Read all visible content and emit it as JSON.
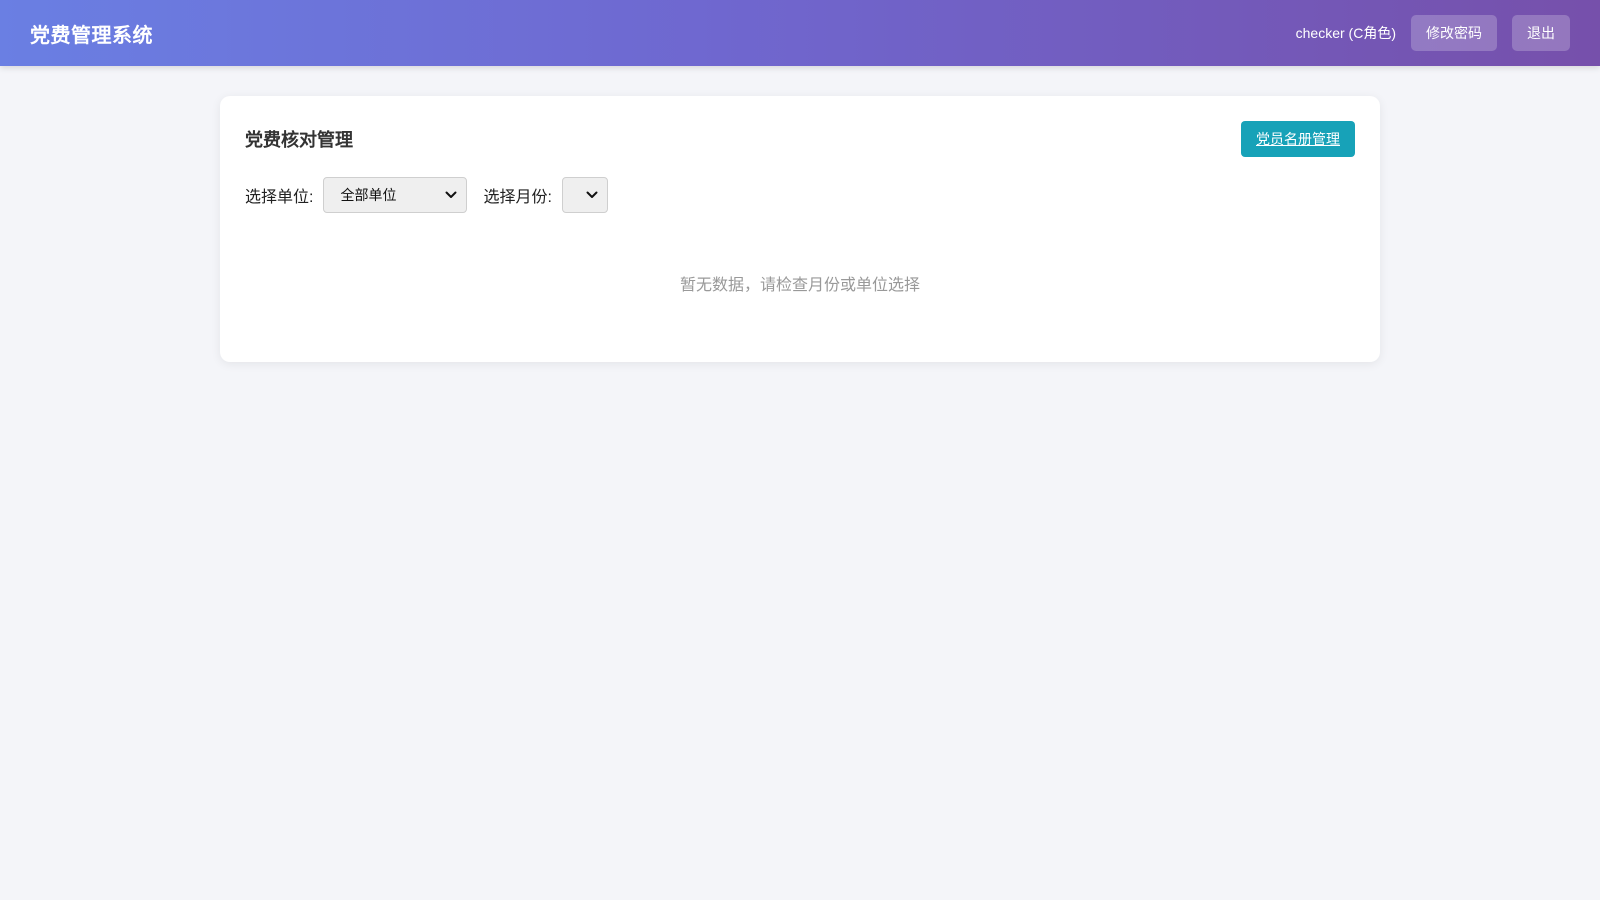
{
  "header": {
    "app_title": "党费管理系统",
    "user_info": "checker (C角色)",
    "change_password_label": "修改密码",
    "logout_label": "退出"
  },
  "main": {
    "title": "党费核对管理",
    "roster_button_label": "党员名册管理",
    "filters": {
      "unit_label": "选择单位:",
      "unit_selected": "全部单位",
      "month_label": "选择月份:",
      "month_selected": ""
    },
    "empty_message": "暂无数据，请检查月份或单位选择"
  },
  "colors": {
    "header_gradient_start": "#6a7fe3",
    "header_gradient_end": "#7650ab",
    "roster_button": "#17a2b8",
    "page_background": "#f4f5f9"
  },
  "icons": {
    "select_arrow": "chevron-down-icon"
  }
}
